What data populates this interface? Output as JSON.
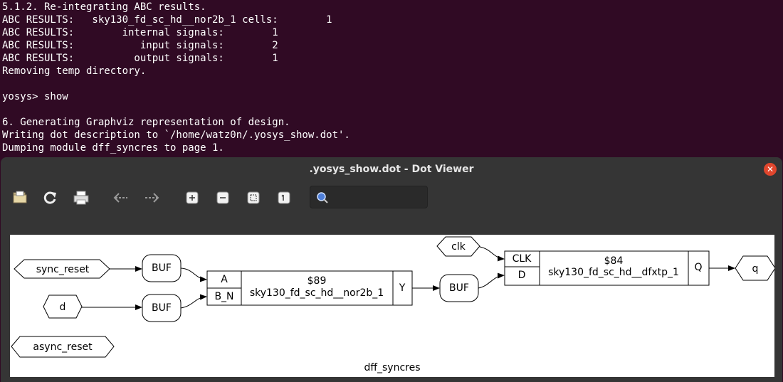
{
  "terminal": {
    "lines": [
      "5.1.2. Re-integrating ABC results.",
      "ABC RESULTS:   sky130_fd_sc_hd__nor2b_1 cells:        1",
      "ABC RESULTS:        internal signals:        1",
      "ABC RESULTS:           input signals:        2",
      "ABC RESULTS:          output signals:        1",
      "Removing temp directory.",
      "",
      "yosys> show",
      "",
      "6. Generating Graphviz representation of design.",
      "Writing dot description to `/home/watz0n/.yosys_show.dot'.",
      "Dumping module dff_syncres to page 1."
    ]
  },
  "viewer": {
    "title": ".yosys_show.dot - Dot Viewer",
    "close_icon": "close-icon",
    "toolbar": [
      {
        "name": "open-file-icon",
        "label": "Open"
      },
      {
        "name": "reload-icon",
        "label": "Reload"
      },
      {
        "name": "print-icon",
        "label": "Print"
      },
      {
        "name": "back-icon",
        "label": "Back"
      },
      {
        "name": "forward-icon",
        "label": "Forward"
      },
      {
        "name": "zoom-in-icon",
        "label": "Zoom in"
      },
      {
        "name": "zoom-out-icon",
        "label": "Zoom out"
      },
      {
        "name": "zoom-fit-icon",
        "label": "Zoom to fit"
      },
      {
        "name": "zoom-100-icon",
        "label": "Zoom 100%"
      }
    ],
    "search": {
      "value": "",
      "placeholder": ""
    }
  },
  "graph": {
    "module_name": "dff_syncres",
    "ports": {
      "sync_reset": "sync_reset",
      "d": "d",
      "async_reset": "async_reset",
      "clk": "clk",
      "q": "q"
    },
    "buffers": [
      "BUF",
      "BUF",
      "BUF"
    ],
    "nor_cell": {
      "id": "$89",
      "type": "sky130_fd_sc_hd__nor2b_1",
      "inputs": [
        "A",
        "B_N"
      ],
      "output": "Y"
    },
    "dff_cell": {
      "id": "$84",
      "type": "sky130_fd_sc_hd__dfxtp_1",
      "inputs": [
        "CLK",
        "D"
      ],
      "output": "Q"
    }
  },
  "colors": {
    "terminal_bg": "#300a24",
    "viewer_bg": "#353535",
    "close": "#e0462d"
  }
}
